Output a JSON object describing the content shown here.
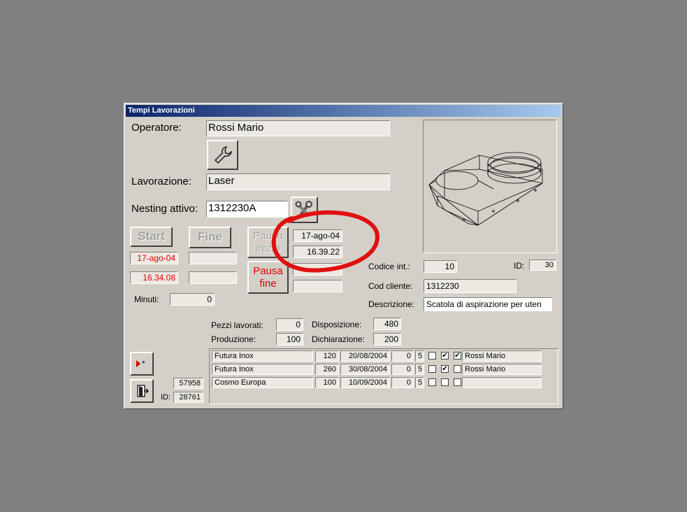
{
  "window": {
    "title": "Tempi Lavorazioni"
  },
  "operatore": {
    "label": "Operatore:",
    "value": "Rossi Mario"
  },
  "lavorazione": {
    "label": "Lavorazione:",
    "value": "Laser"
  },
  "nesting": {
    "label": "Nesting attivo:",
    "value": "1312230A"
  },
  "buttons": {
    "start": "Start",
    "fine": "Fine",
    "pausa_inizio": "Pausa inizio",
    "pausa_fine": "Pausa fine"
  },
  "start": {
    "date": "17-ago-04",
    "time": "16.34.08"
  },
  "fine": {
    "date": "",
    "time": ""
  },
  "pausa_inizio": {
    "date": "17-ago-04",
    "time": "16.39.22"
  },
  "pausa_fine": {
    "date": "",
    "time": ""
  },
  "minuti": {
    "label": "Minuti:",
    "value": "0"
  },
  "codice_int": {
    "label": "Codice  int.:",
    "value": "10"
  },
  "id_top": {
    "label": "ID:",
    "value": "30"
  },
  "cod_cliente": {
    "label": "Cod cliente:",
    "value": "1312230"
  },
  "descrizione": {
    "label": "Descrizione:",
    "value": "Scatola di aspirazione per uten"
  },
  "pezzi_lavorati": {
    "label": "Pezzi lavorati:",
    "value": "0"
  },
  "produzione": {
    "label": "Produzione:",
    "value": "100"
  },
  "disposizione": {
    "label": "Disposizione:",
    "value": "480"
  },
  "dichiarazione": {
    "label": "Dichiarazione:",
    "value": "200"
  },
  "footer": {
    "number": "57958",
    "id_label": "ID:",
    "id_value": "28761"
  },
  "rows": [
    {
      "cliente": "Futura Inox",
      "qty": "120",
      "date": "20/08/2004",
      "n1": "0",
      "n2": "5",
      "c1": false,
      "c2": true,
      "c3": true,
      "operator": "Rossi Mario"
    },
    {
      "cliente": "Futura Inox",
      "qty": "260",
      "date": "30/08/2004",
      "n1": "0",
      "n2": "5",
      "c1": false,
      "c2": true,
      "c3": false,
      "operator": "Rossi Mario"
    },
    {
      "cliente": "Cosmo Europa",
      "qty": "100",
      "date": "10/09/2004",
      "n1": "0",
      "n2": "5",
      "c1": false,
      "c2": false,
      "c3": false,
      "operator": ""
    }
  ],
  "colors": {
    "red_text": "#e00000",
    "annotation": "#e01010",
    "titlebar": "#0a246a"
  },
  "icons": [
    "wrench-icon",
    "wrenches-icon",
    "new-record-icon",
    "exit-door-icon"
  ]
}
